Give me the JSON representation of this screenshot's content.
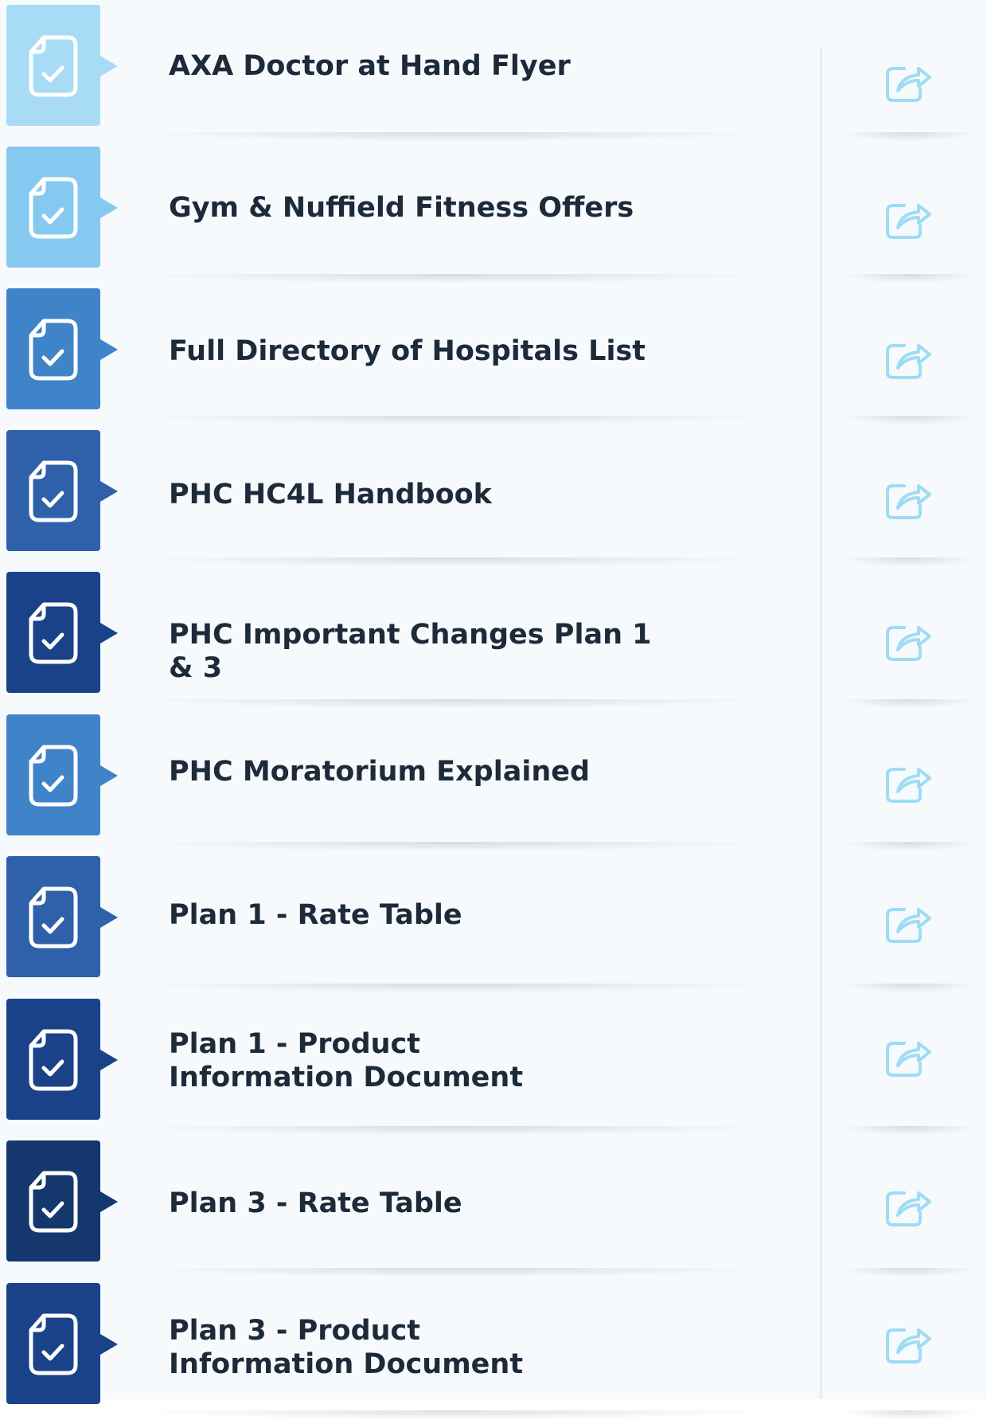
{
  "documents": [
    {
      "title": "AXA Doctor at Hand Flyer",
      "tile_color": "#a8dcf6",
      "icon": "document-check-icon",
      "action_icon": "share-icon"
    },
    {
      "title": "Gym & Nuffield Fitness Offers",
      "tile_color": "#86c9f0",
      "icon": "document-check-icon",
      "action_icon": "share-icon"
    },
    {
      "title": "Full Directory of Hospitals List",
      "tile_color": "#3f83c9",
      "icon": "document-check-icon",
      "action_icon": "share-icon"
    },
    {
      "title": "PHC HC4L Handbook",
      "tile_color": "#2f60aa",
      "icon": "document-check-icon",
      "action_icon": "share-icon"
    },
    {
      "title": "PHC Important Changes Plan 1 & 3",
      "tile_color": "#1a4288",
      "icon": "document-check-icon",
      "action_icon": "share-icon"
    },
    {
      "title": "PHC Moratorium Explained",
      "tile_color": "#3f83c9",
      "icon": "document-check-icon",
      "action_icon": "share-icon"
    },
    {
      "title": "Plan 1 - Rate Table",
      "tile_color": "#2f60aa",
      "icon": "document-check-icon",
      "action_icon": "share-icon"
    },
    {
      "title": "Plan 1 - Product Information Document",
      "tile_color": "#1a4288",
      "icon": "document-check-icon",
      "action_icon": "share-icon"
    },
    {
      "title": "Plan 3 - Rate Table",
      "tile_color": "#14386d",
      "icon": "document-check-icon",
      "action_icon": "share-icon"
    },
    {
      "title": "Plan 3 - Product Information Document",
      "tile_color": "#1a4288",
      "icon": "document-check-icon",
      "action_icon": "share-icon"
    }
  ],
  "share_icon_color": "#9fdcf4"
}
